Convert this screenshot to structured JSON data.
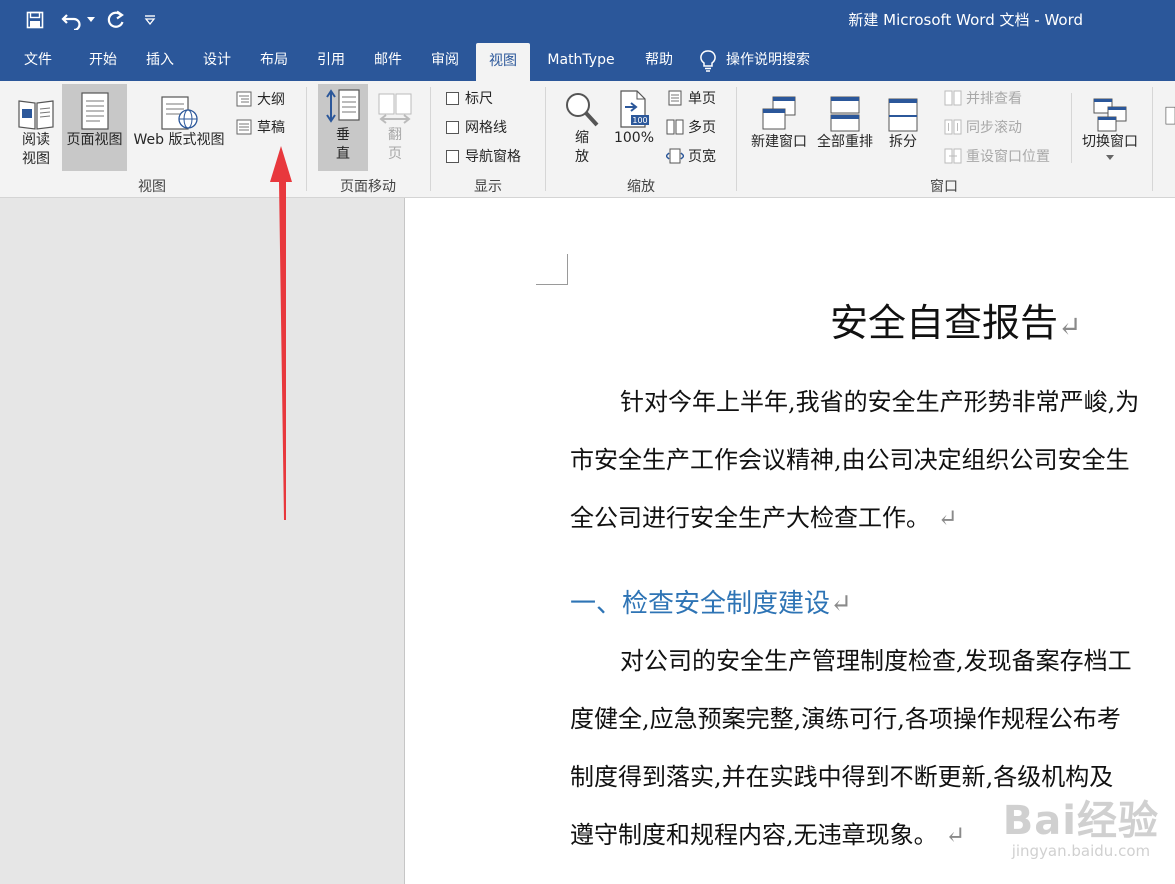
{
  "window": {
    "title": "新建 Microsoft Word 文档  -  Word"
  },
  "quick_access": {
    "icons": [
      "save-icon",
      "undo-icon",
      "dropdown-arrow-icon",
      "redo-icon",
      "customize-qat-icon"
    ]
  },
  "tabs": [
    {
      "label": "文件"
    },
    {
      "label": "开始"
    },
    {
      "label": "插入"
    },
    {
      "label": "设计"
    },
    {
      "label": "布局"
    },
    {
      "label": "引用"
    },
    {
      "label": "邮件"
    },
    {
      "label": "审阅"
    },
    {
      "label": "视图"
    },
    {
      "label": "MathType"
    },
    {
      "label": "帮助"
    }
  ],
  "active_tab": "视图",
  "tell_me": {
    "label": "操作说明搜索",
    "icon": "lightbulb-icon"
  },
  "ribbon": {
    "views": {
      "label": "视图",
      "read_mode": {
        "line1": "阅读",
        "line2": "视图"
      },
      "print_layout": {
        "label": "页面视图"
      },
      "web_layout": {
        "label": "Web 版式视图"
      },
      "outline": {
        "label": "大纲"
      },
      "draft": {
        "label": "草稿"
      }
    },
    "page_movement": {
      "label": "页面移动",
      "vertical": {
        "line1": "垂",
        "line2": "直"
      },
      "side_to_side": {
        "line1": "翻",
        "line2": "页"
      }
    },
    "show": {
      "label": "显示",
      "ruler": "标尺",
      "gridlines": "网格线",
      "nav_pane": "导航窗格"
    },
    "zoom": {
      "label": "缩放",
      "zoom": {
        "line1": "缩",
        "line2": "放"
      },
      "zoom_100": "100%",
      "zoom_100_badge": "100",
      "one_page": "单页",
      "multiple_pages": "多页",
      "page_width": "页宽"
    },
    "window": {
      "label": "窗口",
      "new_window": "新建窗口",
      "arrange_all": "全部重排",
      "split": "拆分",
      "view_side_by_side": "并排查看",
      "sync_scroll": "同步滚动",
      "reset_position": "重设窗口位置",
      "switch_windows": "切换窗口"
    }
  },
  "document": {
    "title": "安全自查报告",
    "para1": [
      "针对今年上半年,我省的安全生产形势非常严峻,为",
      "市安全生产工作会议精神,由公司决定组织公司安全生",
      "全公司进行安全生产大检查工作。"
    ],
    "heading1": "一、检查安全制度建设",
    "para2": [
      "对公司的安全生产管理制度检查,发现备案存档工",
      "度健全,应急预案完整,演练可行,各项操作规程公布考",
      "制度得到落实,并在实践中得到不断更新,各级机构及",
      "遵守制度和规程内容,无违章现象。"
    ],
    "para_mark": "↵"
  },
  "watermark": {
    "line1": "Bai经验",
    "line2": "jingyan.baidu.com"
  },
  "colors": {
    "titlebar": "#2b579a",
    "ribbon_bg": "#f3f3f3",
    "heading": "#2e74b5",
    "annotation_arrow": "#e8383d"
  }
}
